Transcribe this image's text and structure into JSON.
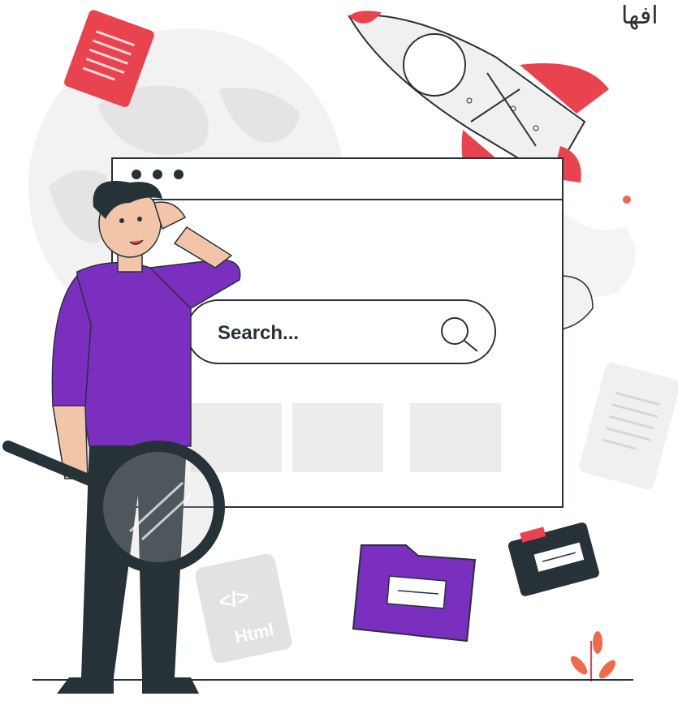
{
  "caption_fragment": "افها",
  "search_bar": {
    "placeholder": "Search..."
  },
  "html_file": {
    "code_symbol": "</>",
    "label": "Html"
  },
  "colors": {
    "accent_purple": "#7b2fbf",
    "accent_red": "#e8434f",
    "dark": "#263238",
    "light_gray": "#e8e8e8"
  }
}
